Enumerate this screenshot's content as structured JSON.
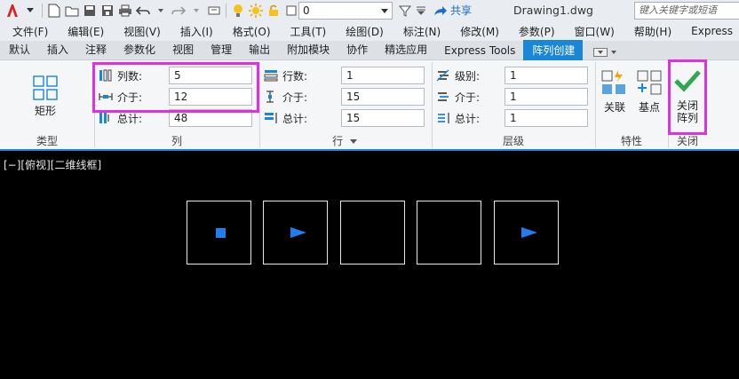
{
  "app": {
    "title": "Drawing1.dwg",
    "search_placeholder": "键入关键字或短语",
    "share_label": "共享",
    "layer_value": "0"
  },
  "menu": [
    "文件(F)",
    "编辑(E)",
    "视图(V)",
    "插入(I)",
    "格式(O)",
    "工具(T)",
    "绘图(D)",
    "标注(N)",
    "修改(M)",
    "参数(P)",
    "窗口(W)",
    "帮助(H)",
    "Express"
  ],
  "tabs": [
    {
      "label": "默认",
      "active": false
    },
    {
      "label": "插入",
      "active": false
    },
    {
      "label": "注释",
      "active": false
    },
    {
      "label": "参数化",
      "active": false
    },
    {
      "label": "视图",
      "active": false
    },
    {
      "label": "管理",
      "active": false
    },
    {
      "label": "输出",
      "active": false
    },
    {
      "label": "附加模块",
      "active": false
    },
    {
      "label": "协作",
      "active": false
    },
    {
      "label": "精选应用",
      "active": false
    },
    {
      "label": "Express Tools",
      "active": false
    },
    {
      "label": "阵列创建",
      "active": true
    }
  ],
  "ribbon": {
    "type_panel": {
      "title": "类型",
      "button": "矩形"
    },
    "col_panel": {
      "title": "列",
      "count_label": "列数:",
      "count": "5",
      "between_label": "介于:",
      "between": "12",
      "total_label": "总计:",
      "total": "48"
    },
    "row_panel": {
      "title": "行",
      "count_label": "行数:",
      "count": "1",
      "between_label": "介于:",
      "between": "15",
      "total_label": "总计:",
      "total": "15"
    },
    "level_panel": {
      "title": "层级",
      "count_label": "级别:",
      "count": "1",
      "between_label": "介于:",
      "between": "1",
      "total_label": "总计:",
      "total": "1"
    },
    "props_panel": {
      "title": "特性",
      "assoc": "关联",
      "base": "基点"
    },
    "close_panel": {
      "title": "关闭",
      "button_line1": "关闭",
      "button_line2": "阵列"
    }
  },
  "viewport": {
    "label": "[−][俯视][二维线框]"
  },
  "colors": {
    "accent": "#1a86d6",
    "highlight": "#e030e0",
    "close_check": "#2fa84f"
  }
}
